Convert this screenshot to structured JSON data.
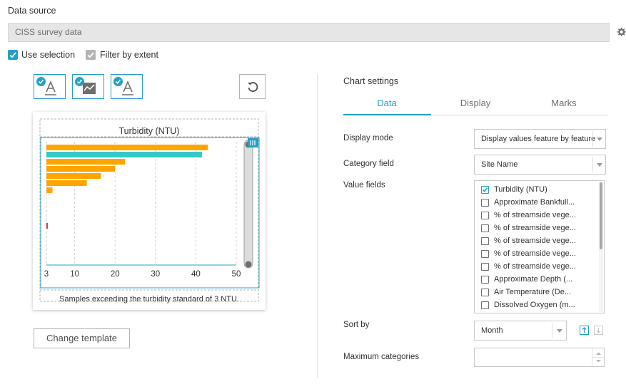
{
  "data_source": {
    "label": "Data source",
    "value": "CISS survey data",
    "use_selection": "Use selection",
    "filter_by_extent": "Filter by extent"
  },
  "template_buttons": [
    "text-template",
    "chart-template",
    "text-template"
  ],
  "preview": {
    "title": "Turbidity (NTU)",
    "footer": "Samples exceeding the turbidity standard of 3 NTU."
  },
  "change_template": "Change template",
  "chart_settings": {
    "title": "Chart settings",
    "tabs": [
      "Data",
      "Display",
      "Marks"
    ],
    "active_tab": "Data",
    "display_mode_label": "Display mode",
    "display_mode_value": "Display values feature by feature",
    "category_field_label": "Category field",
    "category_field_value": "Site Name",
    "value_fields_label": "Value fields",
    "value_fields": [
      {
        "label": "Turbidity (NTU)",
        "checked": true
      },
      {
        "label": "Approximate Bankfull...",
        "checked": false
      },
      {
        "label": "% of streamside vege...",
        "checked": false
      },
      {
        "label": "% of streamside vege...",
        "checked": false
      },
      {
        "label": "% of streamside vege...",
        "checked": false
      },
      {
        "label": "% of streamside vege...",
        "checked": false
      },
      {
        "label": "% of streamside vege...",
        "checked": false
      },
      {
        "label": "Approximate Depth (...",
        "checked": false
      },
      {
        "label": "Air Temperature (De...",
        "checked": false
      },
      {
        "label": "Dissolved Oxygen (m...",
        "checked": false
      }
    ],
    "sort_by_label": "Sort by",
    "sort_by_value": "Month",
    "max_categories_label": "Maximum categories",
    "max_categories_value": ""
  },
  "colors": {
    "accent": "#24a0c8",
    "bar_orange": "#ffa500",
    "bar_teal": "#33c9c9",
    "bar_red": "#e8353b"
  },
  "chart_data": {
    "type": "bar",
    "orientation": "horizontal",
    "title": "Turbidity (NTU)",
    "xlim": [
      3,
      50
    ],
    "xticks": [
      3,
      10,
      20,
      30,
      40,
      50
    ],
    "series": [
      {
        "values": [
          43,
          41.5,
          22.5,
          20,
          16.5,
          13,
          4.5,
          3.3
        ]
      }
    ],
    "bar_colors": [
      "#ffa500",
      "#33c9c9",
      "#ffa500",
      "#ffa500",
      "#ffa500",
      "#ffa500",
      "#ffa500",
      "#e8353b"
    ],
    "grid": true
  }
}
